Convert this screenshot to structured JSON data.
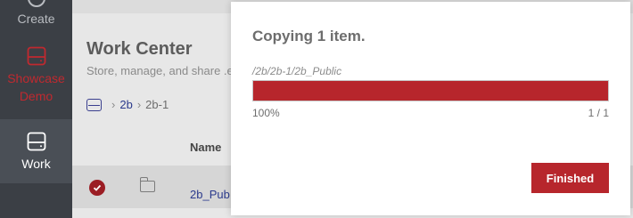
{
  "sidebar": {
    "items": [
      {
        "label": "Create",
        "icon": "plus-circle-icon"
      },
      {
        "label": "Showcase Demo",
        "icon": "drive-icon"
      },
      {
        "label": "Work",
        "icon": "drive-icon"
      }
    ]
  },
  "main": {
    "title": "Work Center",
    "subtitle": "Store, manage, and share .e",
    "breadcrumb": {
      "root_icon": "drive-icon",
      "items": [
        "2b",
        "2b-1"
      ]
    },
    "table": {
      "name_header": "Name",
      "row": {
        "name": "2b_Pub"
      }
    }
  },
  "modal": {
    "title": "Copying 1 item.",
    "path": "/2b/2b-1/2b_Public",
    "progress_value": 1.0,
    "percent_label": "100%",
    "count_label": "1 / 1",
    "finished_label": "Finished"
  },
  "colors": {
    "accent": "#b7262c",
    "sidebar_bg": "#3b3f45",
    "link": "#2b3a8c"
  }
}
